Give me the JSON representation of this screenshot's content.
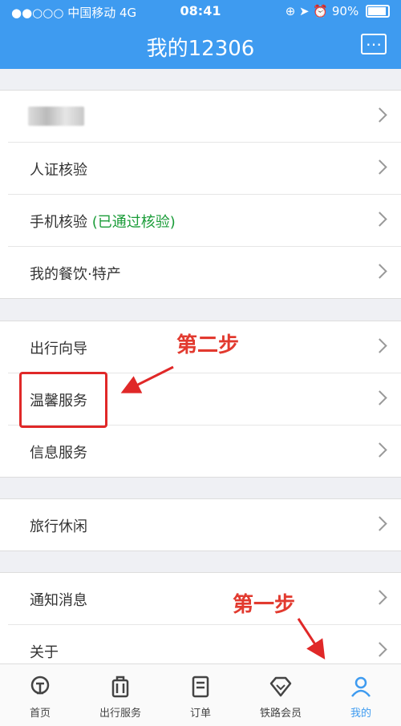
{
  "status": {
    "carrier": "●●○○○ 中国移动 4G",
    "time": "08:41",
    "battery": "90%"
  },
  "header": {
    "title": "我的12306"
  },
  "section1": {
    "items": [
      {
        "label": ""
      },
      {
        "label": "人证核验"
      },
      {
        "label": "手机核验",
        "status": "(已通过核验)"
      },
      {
        "label": "我的餐饮·特产"
      }
    ]
  },
  "section2": {
    "items": [
      {
        "label": "出行向导"
      },
      {
        "label": "温馨服务"
      },
      {
        "label": "信息服务"
      }
    ]
  },
  "section3": {
    "items": [
      {
        "label": "旅行休闲"
      }
    ]
  },
  "section4": {
    "items": [
      {
        "label": "通知消息"
      },
      {
        "label": "关于"
      }
    ]
  },
  "annotations": {
    "step2": "第二步",
    "step1": "第一步"
  },
  "tabs": [
    {
      "label": "首页",
      "icon": "train-icon"
    },
    {
      "label": "出行服务",
      "icon": "luggage-icon"
    },
    {
      "label": "订单",
      "icon": "order-icon"
    },
    {
      "label": "铁路会员",
      "icon": "diamond-icon"
    },
    {
      "label": "我的",
      "icon": "user-icon"
    }
  ],
  "colors": {
    "brand": "#3e9bf0",
    "annotation": "#e23a2f",
    "verified": "#1a9c38"
  }
}
